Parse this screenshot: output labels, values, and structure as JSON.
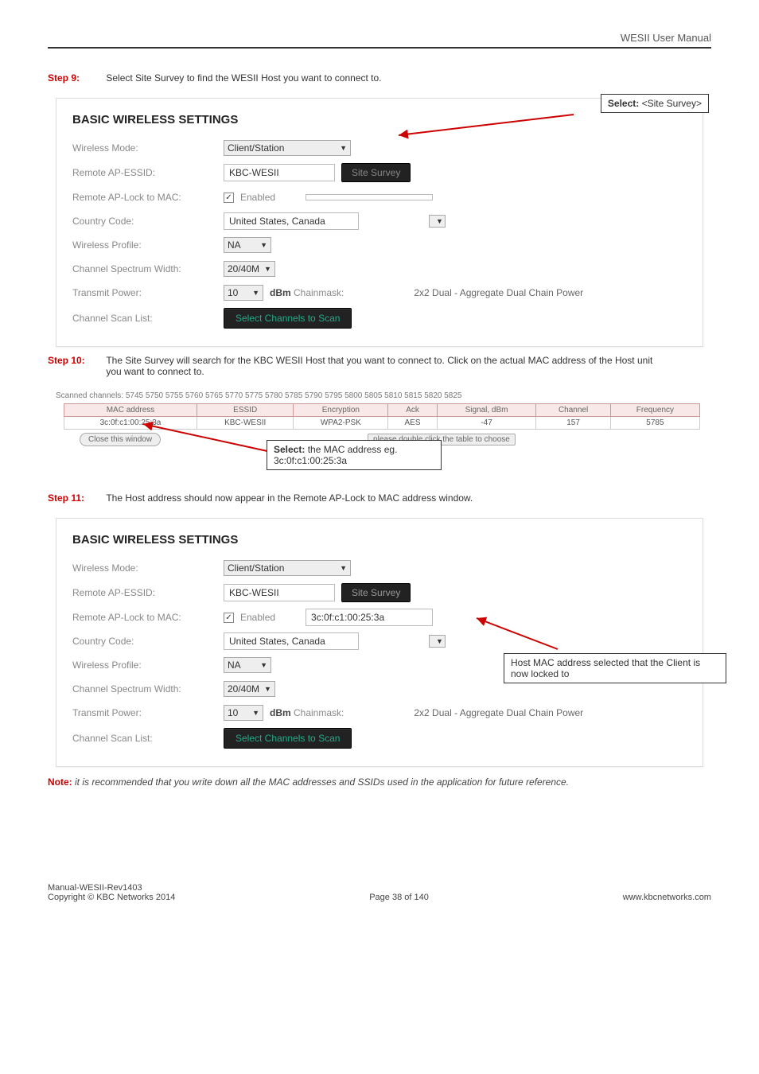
{
  "header": {
    "title": "WESII User Manual"
  },
  "step9": {
    "label": "Step 9:",
    "text": "Select Site Survey to find the WESII Host you want to connect to."
  },
  "callout1": {
    "bold": "Select:",
    "text": "  <Site Survey>"
  },
  "panel1": {
    "title": "BASIC WIRELESS SETTINGS",
    "wireless_mode_label": "Wireless Mode:",
    "wireless_mode": "Client/Station",
    "remote_essid_label": "Remote AP-ESSID:",
    "remote_essid": "KBC-WESII",
    "site_survey": "Site Survey",
    "aplock_label": "Remote AP-Lock to MAC:",
    "aplock_enabled": "Enabled",
    "aplock_value": "",
    "country_label": "Country Code:",
    "country": "United States, Canada",
    "profile_label": "Wireless Profile:",
    "profile": "NA",
    "spectrum_label": "Channel Spectrum Width:",
    "spectrum": "20/40M",
    "txpower_label": "Transmit Power:",
    "txpower": "10",
    "dbm_prefix": "dBm",
    "dbm_suffix": " Chainmask:",
    "chain_info": "2x2 Dual - Aggregate Dual Chain Power",
    "scanlist_label": "Channel Scan List:",
    "scanlist_btn": "Select Channels to Scan"
  },
  "step10": {
    "label": "Step 10:",
    "text": "The Site Survey will search for the KBC WESII Host that you want to connect to. Click on the actual MAC address of the Host unit you want to connect to."
  },
  "scantext": {
    "line": "Scanned channels: 5745 5750 5755 5760 5765 5770 5775 5780 5785 5790 5795 5800 5805 5810 5815 5820 5825"
  },
  "scantable": {
    "h1": "MAC address",
    "h2": "ESSID",
    "h3": "Encryption",
    "h4": "Ack",
    "h5": "Signal, dBm",
    "h6": "Channel",
    "h7": "Frequency",
    "r1c1": "3c:0f:c1:00:25:3a",
    "r1c2": "KBC-WESII",
    "r1c3": "WPA2-PSK",
    "r1c4": "AES",
    "r1c5": "-47",
    "r1c6": "157",
    "r1c7": "5785",
    "clicker": "please double click the table to choose"
  },
  "closewin": {
    "label": "Close this window"
  },
  "mac_callout": {
    "bold": "Select:",
    "text": "  the MAC address eg. 3c:0f:c1:00:25:3a"
  },
  "step11": {
    "label": "Step 11:",
    "text": "The Host address should now appear in the Remote AP-Lock to MAC address window."
  },
  "panel2": {
    "title": "BASIC WIRELESS SETTINGS",
    "wireless_mode_label": "Wireless Mode:",
    "wireless_mode": "Client/Station",
    "remote_essid_label": "Remote AP-ESSID:",
    "remote_essid": "KBC-WESII",
    "site_survey": "Site Survey",
    "aplock_label": "Remote AP-Lock to MAC:",
    "aplock_enabled": "Enabled",
    "aplock_value": "3c:0f:c1:00:25:3a",
    "country_label": "Country Code:",
    "country": "United States, Canada",
    "profile_label": "Wireless Profile:",
    "profile": "NA",
    "spectrum_label": "Channel Spectrum Width:",
    "spectrum": "20/40M",
    "txpower_label": "Transmit Power:",
    "txpower": "10",
    "dbm_prefix": "dBm",
    "dbm_suffix": " Chainmask:",
    "chain_info": "2x2 Dual - Aggregate Dual Chain Power",
    "scanlist_label": "Channel Scan List:",
    "scanlist_btn": "Select Channels to Scan"
  },
  "callout2": {
    "text": "Host MAC address selected that the Client is now locked to"
  },
  "note": {
    "bold": "Note:",
    "italic": " it is recommended that you write down all the MAC addresses and SSIDs used in the application for future reference."
  },
  "footer": {
    "left1": "Manual-WESII-Rev1403",
    "left2": "Copyright © KBC Networks 2014",
    "center": "Page 38 of 140",
    "right": "www.kbcnetworks.com"
  }
}
